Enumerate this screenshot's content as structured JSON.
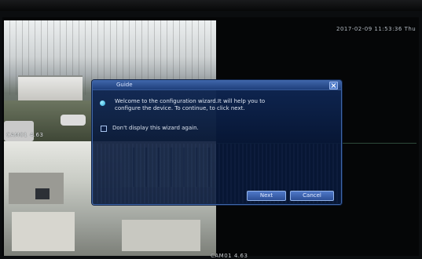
{
  "dialog": {
    "title": "Guide",
    "message": "Welcome to the configuration wizard.It will help you to configure the device. To continue, to click next.",
    "checkbox_label": "Don't display this wizard again.",
    "next_label": "Next",
    "cancel_label": "Cancel",
    "close_glyph": "×"
  },
  "osd": {
    "datetime": "2017-02-09 11:53:36 Thu",
    "cam_label_1": "CAM01 4.63",
    "cam_label_2": "CAM01 4.63"
  },
  "icons": [
    "close-icon",
    "info-bullet-icon",
    "checkbox-icon"
  ],
  "colors": {
    "dialog_bg": "#08183a",
    "titlebar": "#3e64a8",
    "button": "#4f78c8",
    "text": "#dfe6f2"
  }
}
